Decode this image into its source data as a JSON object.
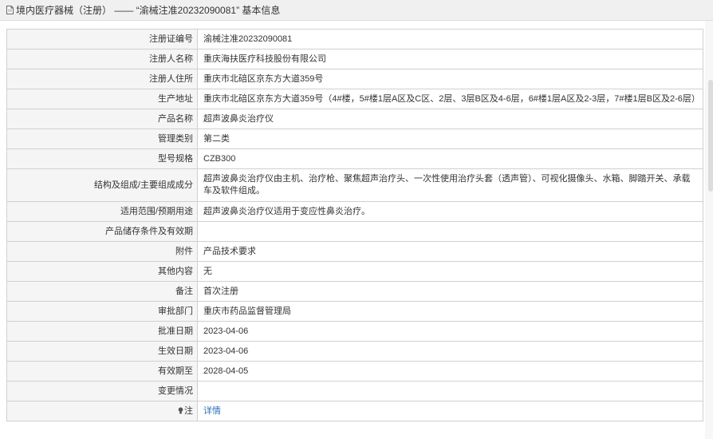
{
  "header": {
    "title": "境内医疗器械（注册） —— “渝械注准20232090081” 基本信息"
  },
  "rows": [
    {
      "label": "注册证编号",
      "value": "渝械注准20232090081"
    },
    {
      "label": "注册人名称",
      "value": "重庆海扶医疗科技股份有限公司"
    },
    {
      "label": "注册人住所",
      "value": "重庆市北碚区京东方大道359号"
    },
    {
      "label": "生产地址",
      "value": "重庆市北碚区京东方大道359号（4#楼，5#楼1层A区及C区、2层、3层B区及4-6层，6#楼1层A区及2-3层，7#楼1层B区及2-6层）"
    },
    {
      "label": "产品名称",
      "value": "超声波鼻炎治疗仪"
    },
    {
      "label": "管理类别",
      "value": "第二类"
    },
    {
      "label": "型号规格",
      "value": "CZB300"
    },
    {
      "label": "结构及组成/主要组成成分",
      "value": "超声波鼻炎治疗仪由主机、治疗枪、聚焦超声治疗头、一次性使用治疗头套（透声管）、可视化摄像头、水箱、脚踏开关、承载车及软件组成。"
    },
    {
      "label": "适用范围/预期用途",
      "value": "超声波鼻炎治疗仪适用于变应性鼻炎治疗。"
    },
    {
      "label": "产品储存条件及有效期",
      "value": ""
    },
    {
      "label": "附件",
      "value": "产品技术要求"
    },
    {
      "label": "其他内容",
      "value": "无"
    },
    {
      "label": "备注",
      "value": "首次注册"
    },
    {
      "label": "审批部门",
      "value": "重庆市药品监督管理局"
    },
    {
      "label": "批准日期",
      "value": "2023-04-06"
    },
    {
      "label": "生效日期",
      "value": "2023-04-06"
    },
    {
      "label": "有效期至",
      "value": "2028-04-05"
    },
    {
      "label": "变更情况",
      "value": ""
    },
    {
      "label": "注",
      "value": "详情"
    }
  ],
  "colors": {
    "link": "#2a6fb8",
    "label_bg": "#f5f5f5",
    "border": "#d0d0d0",
    "header_bg": "#f0f0f0"
  },
  "icons": {
    "header_icon": "document-icon",
    "note_icon": "lightbulb-icon"
  }
}
